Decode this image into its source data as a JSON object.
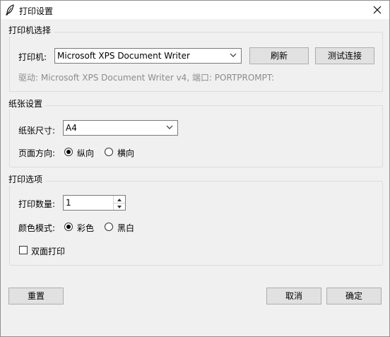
{
  "window": {
    "title": "打印设置",
    "icon": "feather-icon",
    "close_icon": "close-icon"
  },
  "printer_group": {
    "title": "打印机选择",
    "printer_label": "打印机:",
    "printer_selected": "Microsoft XPS Document Writer",
    "refresh_label": "刷新",
    "test_label": "测试连接",
    "driver_info": "驱动: Microsoft XPS Document Writer v4, 端口: PORTPROMPT:"
  },
  "paper_group": {
    "title": "纸张设置",
    "size_label": "纸张尺寸:",
    "size_selected": "A4",
    "orientation_label": "页面方向:",
    "orientation_options": [
      {
        "label": "纵向",
        "selected": true
      },
      {
        "label": "横向",
        "selected": false
      }
    ]
  },
  "print_options": {
    "title": "打印选项",
    "copies_label": "打印数量:",
    "copies_value": "1",
    "color_label": "颜色模式:",
    "color_options": [
      {
        "label": "彩色",
        "selected": true
      },
      {
        "label": "黑白",
        "selected": false
      }
    ],
    "duplex_label": "双面打印",
    "duplex_checked": false
  },
  "footer": {
    "reset_label": "重置",
    "cancel_label": "取消",
    "ok_label": "确定"
  }
}
